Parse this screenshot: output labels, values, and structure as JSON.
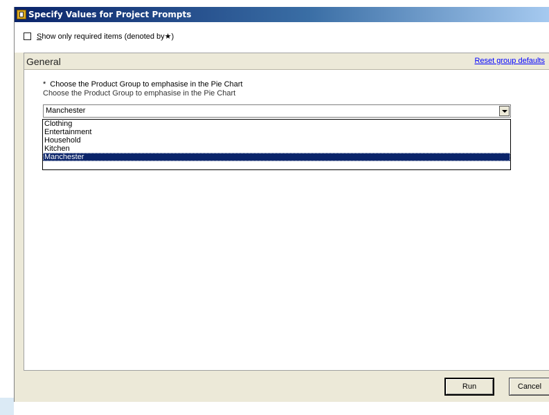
{
  "window": {
    "title": "Specify Values for Project Prompts"
  },
  "options": {
    "show_required_label": "Show only required items (denoted by",
    "show_required_star": "★",
    "show_required_close": ")",
    "show_required_checked": false
  },
  "group": {
    "title": "General",
    "reset_link": "Reset group defaults"
  },
  "prompt": {
    "required_marker": "*",
    "title": "Choose the Product Group to emphasise in the Pie Chart",
    "description": "Choose the Product Group to emphasise in the Pie Chart",
    "selected_value": "Manchester",
    "options": [
      "Clothing",
      "Entertainment",
      "Household",
      "Kitchen",
      "Manchester"
    ]
  },
  "buttons": {
    "run": "Run",
    "cancel": "Cancel"
  },
  "colors": {
    "title_bar": "#0a246a",
    "selection": "#0a246a",
    "link": "#0000ff",
    "dialog_face": "#ece9d8"
  }
}
